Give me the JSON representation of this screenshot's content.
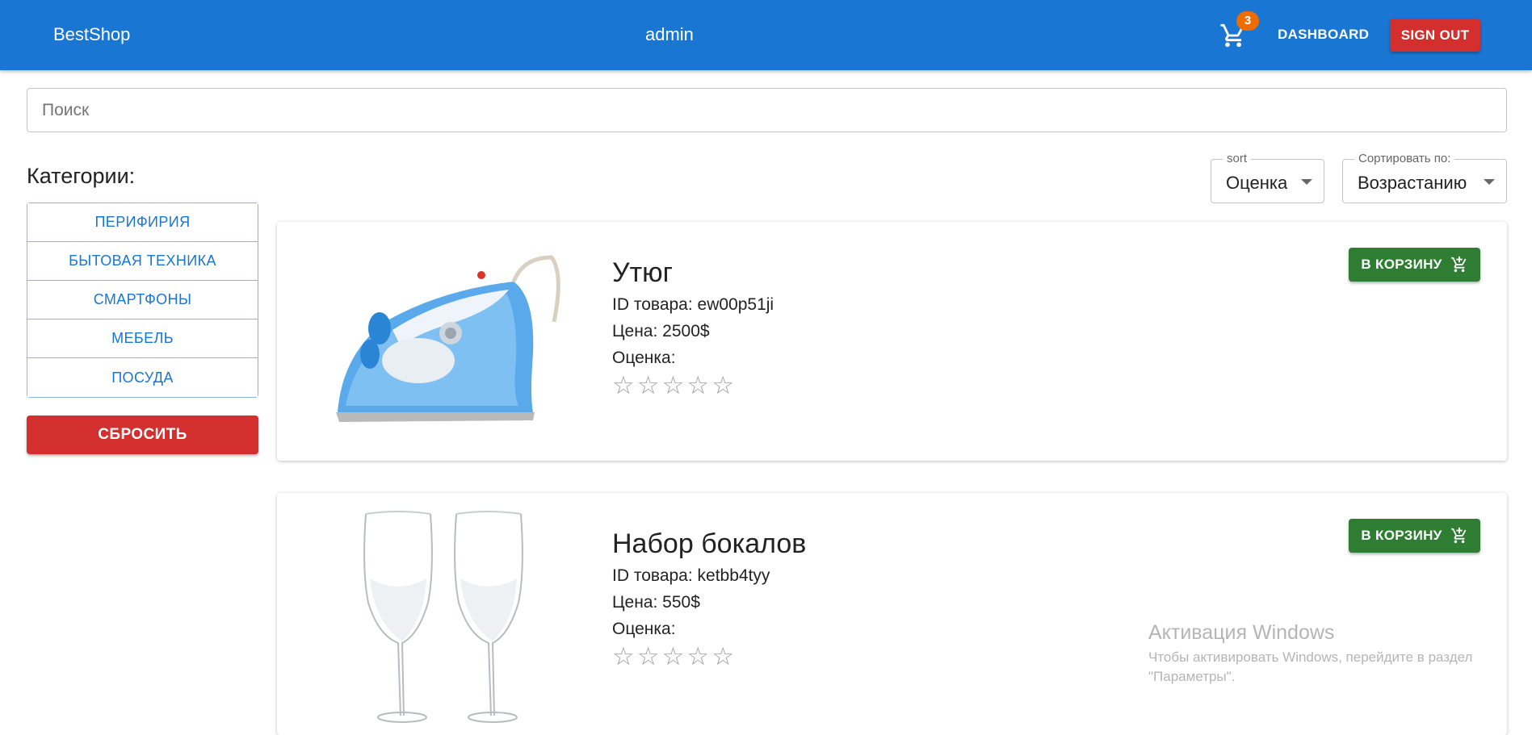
{
  "header": {
    "brand": "BestShop",
    "username": "admin",
    "cart_count": "3",
    "dashboard_label": "DASHBOARD",
    "signout_label": "SIGN OUT"
  },
  "search": {
    "placeholder": "Поиск",
    "value": ""
  },
  "sidebar": {
    "title": "Категории:",
    "categories": [
      {
        "label": "ПЕРИФИРИЯ"
      },
      {
        "label": "БЫТОВАЯ ТЕХНИКА"
      },
      {
        "label": "СМАРТФОНЫ"
      },
      {
        "label": "МЕБЕЛЬ"
      },
      {
        "label": "ПОСУДА"
      }
    ],
    "reset_label": "СБРОСИТЬ"
  },
  "sort": {
    "label": "sort",
    "value": "Оценка"
  },
  "order": {
    "label": "Сортировать по:",
    "value": "Возрастанию"
  },
  "products": [
    {
      "name": "Утюг",
      "id_line": "ID товара: ew00p51ji",
      "price_line": "Цена: 2500$",
      "rating_label": "Оценка:",
      "rating": 0,
      "rating_max": 5,
      "add_label": "В КОРЗИНУ",
      "image_icon": "iron-image"
    },
    {
      "name": "Набор бокалов",
      "id_line": "ID товара: ketbb4tyy",
      "price_line": "Цена: 550$",
      "rating_label": "Оценка:",
      "rating": 0,
      "rating_max": 5,
      "add_label": "В КОРЗИНУ",
      "image_icon": "wine-glasses-image"
    }
  ],
  "watermark": {
    "title": "Активация Windows",
    "line1": "Чтобы активировать Windows, перейдите в раздел",
    "line2": "\"Параметры\"."
  },
  "colors": {
    "appbar": "#1976d2",
    "danger": "#d32f2f",
    "success": "#2e7d32",
    "badge": "#ef6c00",
    "link": "#1976d2"
  }
}
